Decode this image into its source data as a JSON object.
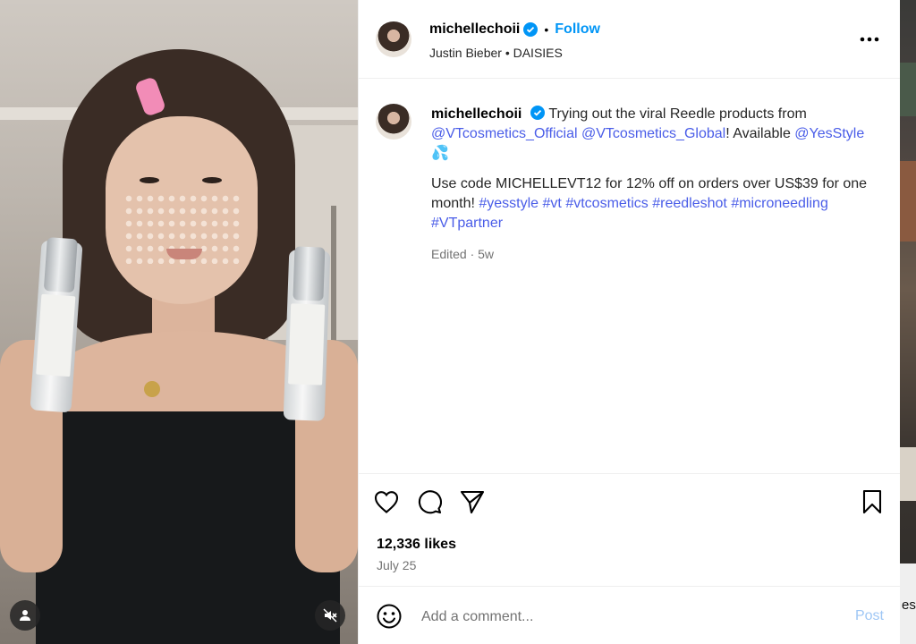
{
  "post": {
    "username": "michellechoii",
    "follow_label": "Follow",
    "separator": "•",
    "audio": "Justin Bieber • DAISIES",
    "caption": {
      "intro": "Trying out the viral Reedle products from",
      "mention1": "@VTcosmetics_Official",
      "mention2": "@VTcosmetics_Global",
      "mid": "! Available",
      "mention3": "@YesStyle",
      "emoji": "💦",
      "promo": "Use code MICHELLEVT12 for 12% off on orders over US$39 for one month!",
      "hashtags": [
        "#yesstyle",
        "#vt",
        "#vtcosmetics",
        "#reedleshot",
        "#microneedling",
        "#VTpartner"
      ]
    },
    "meta": "Edited · 5w",
    "likes": "12,336 likes",
    "date": "July 25"
  },
  "comment_box": {
    "placeholder": "Add a comment...",
    "post_label": "Post"
  },
  "backdrop": {
    "peek_text": "es"
  },
  "colors": {
    "accent": "#0095f6",
    "link": "#4a5de8",
    "muted": "#737373",
    "post_disabled": "#9fc7f5"
  },
  "icons": [
    "verified-badge-icon",
    "more-options-icon",
    "heart-icon",
    "comment-icon",
    "share-icon",
    "bookmark-icon",
    "emoji-icon",
    "user-tag-icon",
    "muted-audio-icon"
  ]
}
